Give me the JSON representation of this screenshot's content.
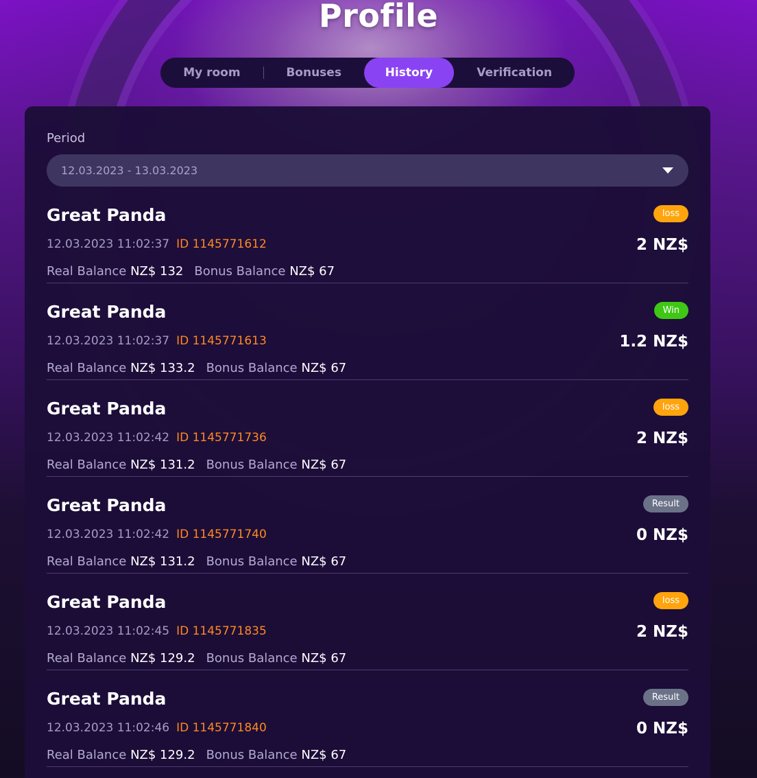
{
  "page": {
    "title": "Profile"
  },
  "tabs": [
    {
      "label": "My room"
    },
    {
      "label": "Bonuses"
    },
    {
      "label": "History"
    },
    {
      "label": "Verification"
    }
  ],
  "filters": {
    "period_label": "Period",
    "period_value": "12.03.2023  - 13.03.2023"
  },
  "labels": {
    "real_balance": "Real Balance",
    "bonus_balance": "Bonus Balance"
  },
  "colors": {
    "loss": "#ffa40d",
    "win": "#3fc716",
    "result": "#6b7288",
    "transaction_id": "#ff8a1f",
    "active_tab": "#8a43f2"
  },
  "history": [
    {
      "game": "Great Panda",
      "datetime": "12.03.2023 11:02:37",
      "tx_id": "ID 1145771612",
      "status": "loss",
      "amount": "2 NZ$",
      "real_balance": "NZ$ 132",
      "bonus_balance": "NZ$ 67"
    },
    {
      "game": "Great Panda",
      "datetime": "12.03.2023 11:02:37",
      "tx_id": "ID 1145771613",
      "status": "Win",
      "amount": "1.2 NZ$",
      "real_balance": "NZ$ 133.2",
      "bonus_balance": "NZ$ 67"
    },
    {
      "game": "Great Panda",
      "datetime": "12.03.2023 11:02:42",
      "tx_id": "ID 1145771736",
      "status": "loss",
      "amount": "2 NZ$",
      "real_balance": "NZ$ 131.2",
      "bonus_balance": "NZ$ 67"
    },
    {
      "game": "Great Panda",
      "datetime": "12.03.2023 11:02:42",
      "tx_id": "ID 1145771740",
      "status": "Result",
      "amount": "0 NZ$",
      "real_balance": "NZ$ 131.2",
      "bonus_balance": "NZ$ 67"
    },
    {
      "game": "Great Panda",
      "datetime": "12.03.2023 11:02:45",
      "tx_id": "ID 1145771835",
      "status": "loss",
      "amount": "2 NZ$",
      "real_balance": "NZ$ 129.2",
      "bonus_balance": "NZ$ 67"
    },
    {
      "game": "Great Panda",
      "datetime": "12.03.2023 11:02:46",
      "tx_id": "ID 1145771840",
      "status": "Result",
      "amount": "0 NZ$",
      "real_balance": "NZ$ 129.2",
      "bonus_balance": "NZ$ 67"
    }
  ]
}
